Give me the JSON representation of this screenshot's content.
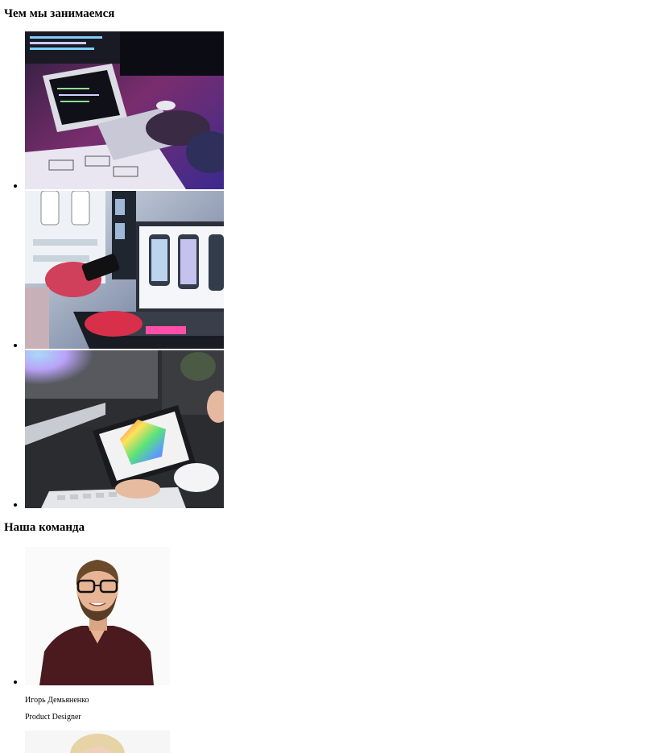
{
  "services": {
    "heading": "Чем мы занимаемся",
    "items": [
      {
        "image": "coding-workspace-photo"
      },
      {
        "image": "mobile-ui-design-photo"
      },
      {
        "image": "color-palette-tablet-photo"
      }
    ]
  },
  "team": {
    "heading": "Наша команда",
    "members": [
      {
        "name": "Игорь Демьяненко",
        "role": "Product Designer",
        "image": "team-member-portrait-man"
      },
      {
        "image": "team-member-portrait-woman"
      }
    ]
  },
  "colors": {
    "background": "#ffffff",
    "text": "#000000"
  }
}
